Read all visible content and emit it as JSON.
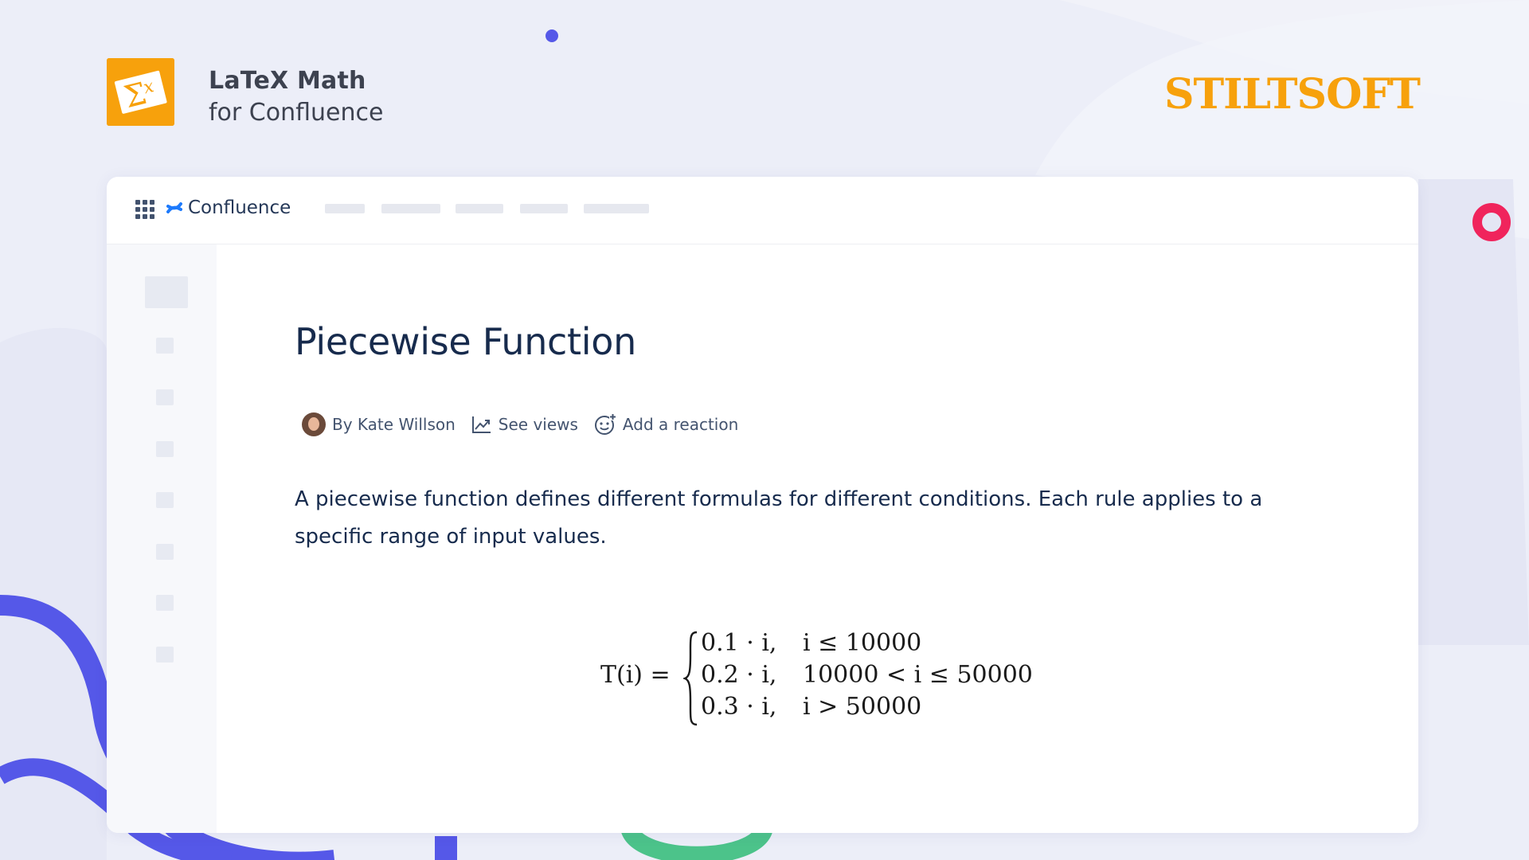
{
  "header": {
    "app_title": "LaTeX Math",
    "app_subtitle": "for Confluence",
    "app_logo_icon": "sigma-x-icon",
    "brand": "STILTSOFT"
  },
  "topbar": {
    "product_name": "Confluence",
    "app_switcher_icon": "grid-icon",
    "product_icon": "confluence-icon"
  },
  "page": {
    "title": "Piecewise Function",
    "byline": {
      "author": "By Kate Willson",
      "views": "See views",
      "reaction": "Add a reaction"
    },
    "paragraph": "A piecewise function defines different formulas for different conditions. Each rule applies to a specific range of input values.",
    "formula": {
      "lhs": "T(i) =",
      "rows": [
        {
          "expr": "0.1 · i,",
          "cond": "i ≤ 10000"
        },
        {
          "expr": "0.2 · i,",
          "cond": "10000 < i ≤ 50000"
        },
        {
          "expr": "0.3 · i,",
          "cond": "i > 50000"
        }
      ]
    }
  },
  "colors": {
    "brand_orange": "#f7a10c",
    "accent_blue": "#5558e8",
    "accent_green": "#4cc38a",
    "accent_red": "#f0245c"
  }
}
